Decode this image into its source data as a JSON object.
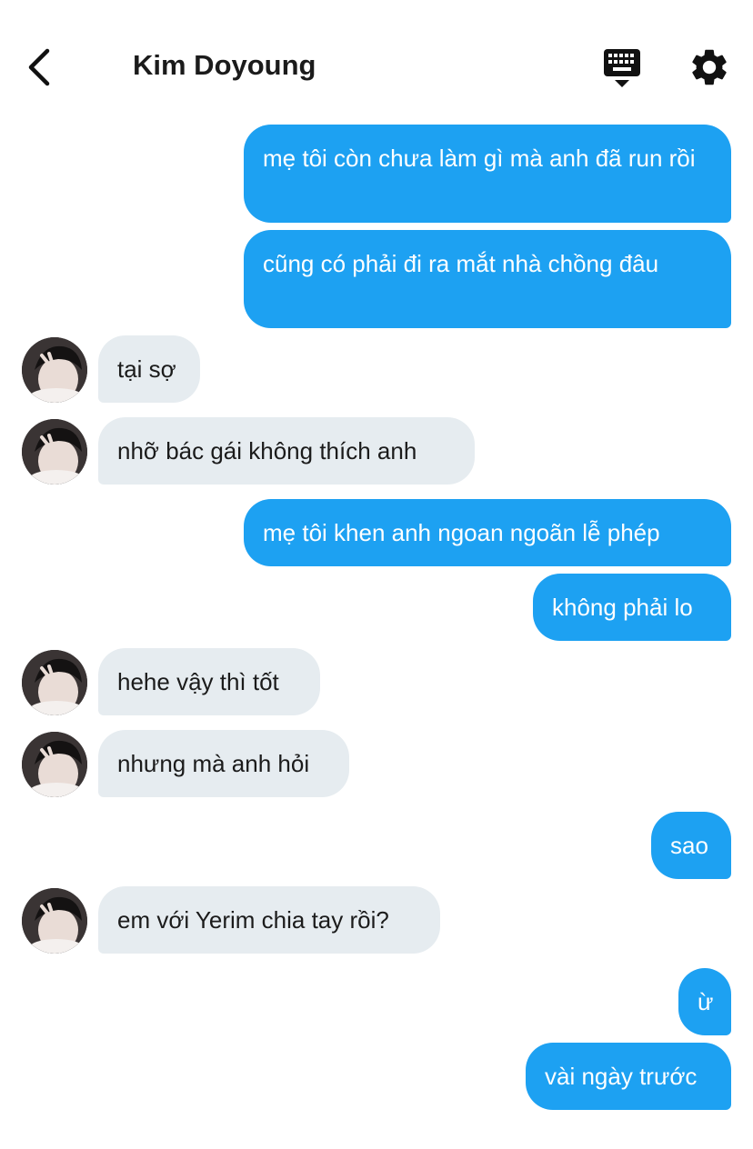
{
  "header": {
    "contact_name": "Kim Doyoung",
    "back_icon": "chevron-left-icon",
    "keyboard_icon": "keyboard-icon",
    "settings_icon": "gear-icon"
  },
  "colors": {
    "outgoing_bubble": "#1da1f2",
    "incoming_bubble": "#e6ecf0"
  },
  "messages": [
    {
      "direction": "outgoing",
      "text": "mẹ tôi còn chưa làm gì mà anh đã run rồi"
    },
    {
      "direction": "outgoing",
      "text": "cũng có phải đi ra mắt nhà chồng đâu"
    },
    {
      "direction": "incoming",
      "text": "tại sợ"
    },
    {
      "direction": "incoming",
      "text": "nhỡ bác gái không thích anh"
    },
    {
      "direction": "outgoing",
      "text": "mẹ tôi khen anh ngoan ngoãn lễ phép"
    },
    {
      "direction": "outgoing",
      "text": "không phải lo"
    },
    {
      "direction": "incoming",
      "text": "hehe vậy thì tốt"
    },
    {
      "direction": "incoming",
      "text": "nhưng mà anh hỏi"
    },
    {
      "direction": "outgoing",
      "text": "sao"
    },
    {
      "direction": "incoming",
      "text": "em với Yerim chia tay rồi?"
    },
    {
      "direction": "outgoing",
      "text": "ừ"
    },
    {
      "direction": "outgoing",
      "text": "vài ngày trước"
    }
  ]
}
